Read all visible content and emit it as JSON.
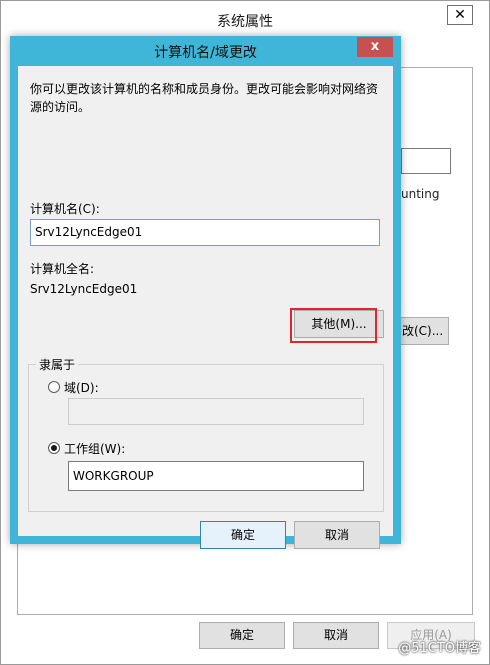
{
  "background_window": {
    "title": "系统属性",
    "close_glyph": "✕",
    "accounting_fragment": "unting",
    "change_button_fragment": "改(C)...",
    "buttons": {
      "ok": "确定",
      "cancel": "取消",
      "apply": "应用(A)"
    }
  },
  "dialog": {
    "title": "计算机名/域更改",
    "close_glyph": "x",
    "description": "你可以更改该计算机的名称和成员身份。更改可能会影响对网络资源的访问。",
    "computer_name_label": "计算机名(C):",
    "computer_name_value": "Srv12LyncEdge01",
    "full_name_label": "计算机全名:",
    "full_name_value": "Srv12LyncEdge01",
    "more_button": "其他(M)...",
    "member_of": {
      "legend": "隶属于",
      "domain_label": "域(D):",
      "domain_value": "",
      "domain_selected": false,
      "workgroup_label": "工作组(W):",
      "workgroup_value": "WORKGROUP",
      "workgroup_selected": true
    },
    "ok_button": "确定",
    "cancel_button": "取消"
  },
  "watermark": "@51CTO博客",
  "colors": {
    "dialog_frame": "#3fb5d7",
    "close_button": "#c75050",
    "highlight_box": "#e0262b"
  }
}
